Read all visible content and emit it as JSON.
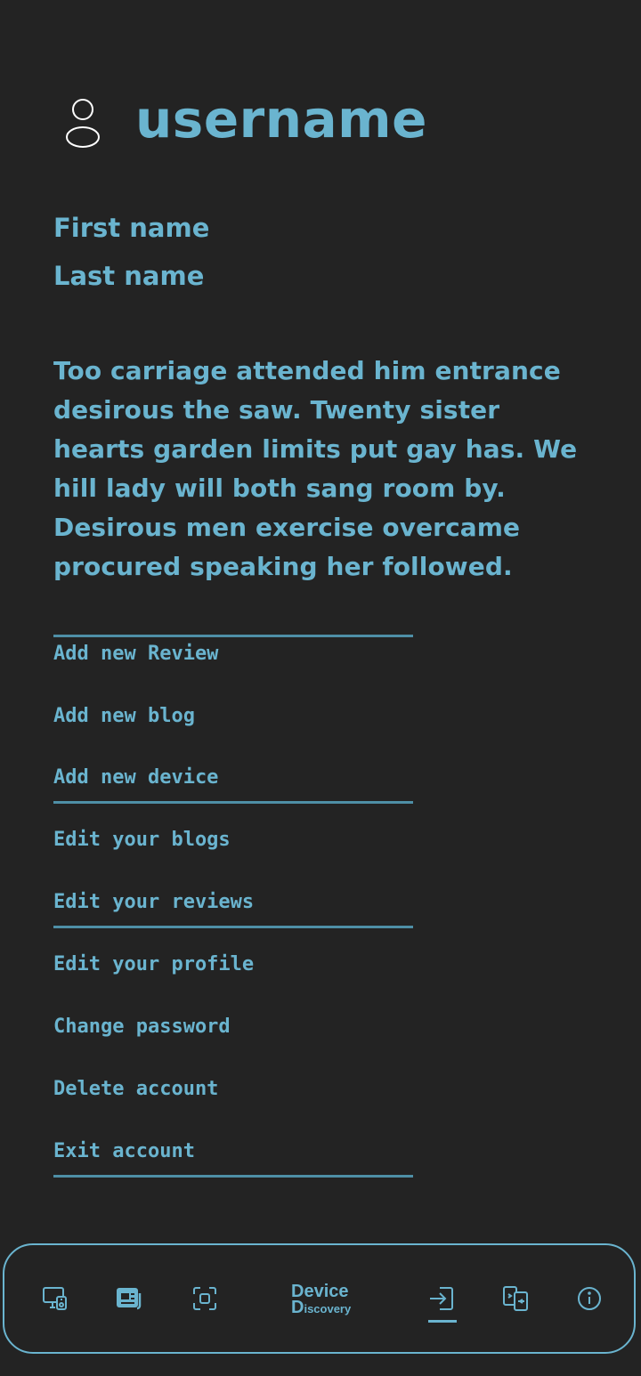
{
  "profile": {
    "username": "username",
    "first_name": "First name",
    "last_name": "Last name",
    "bio": "Too carriage attended him entrance desirous the saw. Twenty sister hearts garden limits put gay has. We hill lady will both sang room by. Desirous men exercise overcame procured speaking her followed."
  },
  "menu": {
    "items": [
      {
        "label": "Add new Review"
      },
      {
        "label": "Add new blog"
      },
      {
        "label": "Add new device"
      },
      {
        "label": "Edit your blogs"
      },
      {
        "label": "Edit your reviews"
      },
      {
        "label": "Edit your profile"
      },
      {
        "label": "Change password"
      },
      {
        "label": "Delete account"
      },
      {
        "label": "Exit account"
      }
    ]
  },
  "bottom_nav": {
    "brand_top": "Device",
    "brand_bottom_initial": "D",
    "brand_bottom_rest": "iscovery",
    "icons": [
      "devices-icon",
      "blog-icon",
      "scan-icon",
      "login-icon",
      "compare-icon",
      "info-icon"
    ],
    "active": "login-icon"
  },
  "colors": {
    "background": "#232323",
    "accent": "#6ab4cf",
    "divider": "#4e8fa6"
  }
}
